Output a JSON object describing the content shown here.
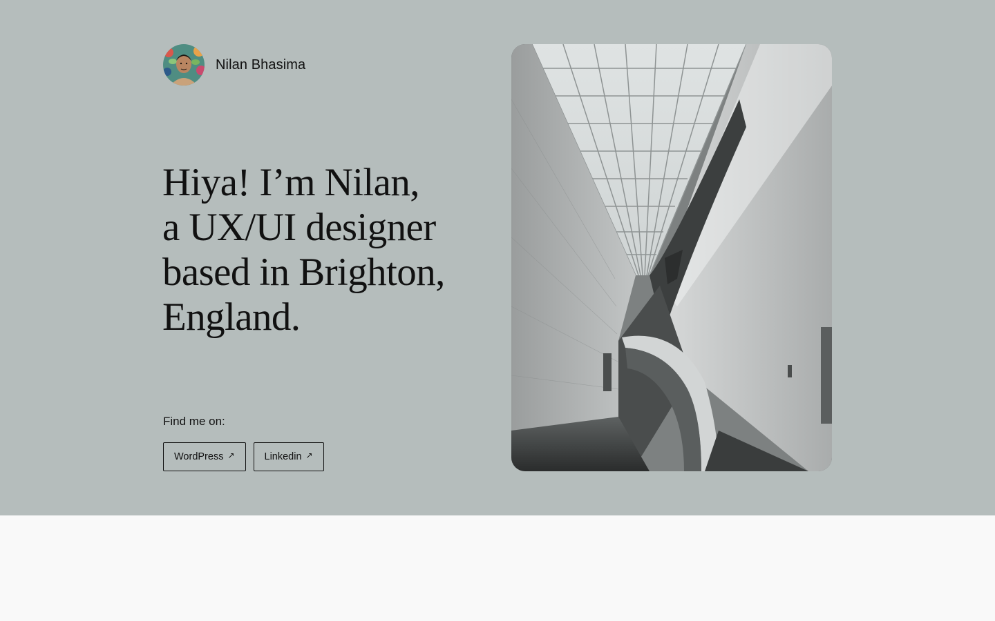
{
  "header": {
    "site_name": "Nilan Bhasima",
    "avatar_icon": "person-avatar-icon"
  },
  "hero": {
    "headline_lines": [
      "Hiya! I’m Nilan,",
      "a UX/UI designer",
      "based in Brighton,",
      "England."
    ],
    "find_label": "Find me on:",
    "links": [
      {
        "label": "WordPress",
        "icon": "external-arrow-icon"
      },
      {
        "label": "Linkedin",
        "icon": "external-arrow-icon"
      }
    ],
    "image_icon": "architecture-interior-photo"
  },
  "colors": {
    "hero_background": "#b5bdbc",
    "page_background": "#f9f9f9",
    "text": "#111111"
  }
}
